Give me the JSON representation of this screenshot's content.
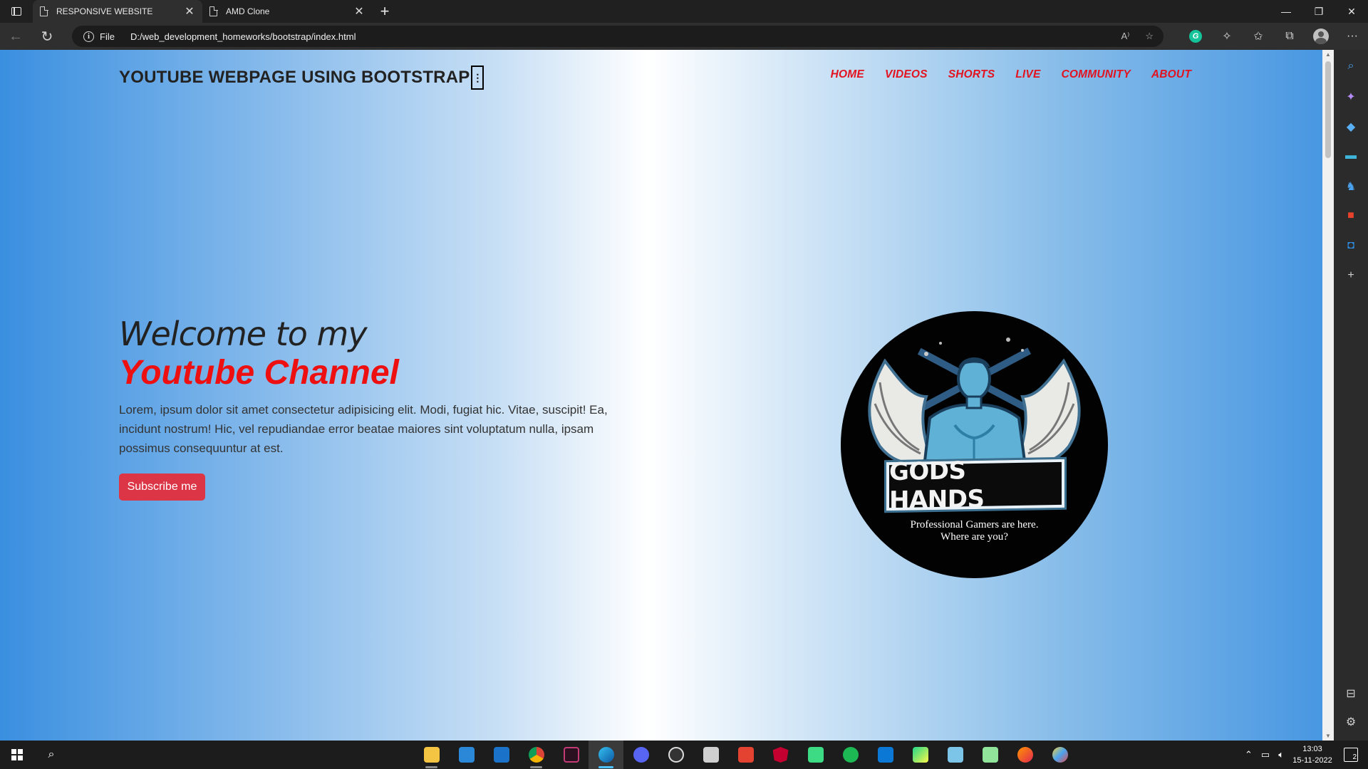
{
  "browser": {
    "tabs": [
      {
        "label": "RESPONSIVE WEBSITE",
        "active": true
      },
      {
        "label": "AMD Clone",
        "active": false
      }
    ],
    "address": {
      "scheme_label": "File",
      "url": "D:/web_development_homeworks/bootstrap/index.html"
    }
  },
  "page": {
    "brand": "YOUTUBE WEBPAGE USING BOOTSTRAP",
    "toggler_glyph": "⋮",
    "nav": [
      "HOME",
      "VIDEOS",
      "SHORTS",
      "LIVE",
      "COMMUNITY",
      "ABOUT"
    ],
    "hero": {
      "line1": "Welcome to my",
      "line2": "Youtube Channel",
      "paragraph": "Lorem, ipsum dolor sit amet consectetur adipisicing elit. Modi, fugiat hic. Vitae, suscipit! Ea, incidunt nostrum! Hic, vel repudiandae error beatae maiores sint voluptatum nulla, ipsam possimus consequuntur at est.",
      "button": "Subscribe me"
    },
    "logo": {
      "title": "GODS HANDS",
      "tagline_1": "Professional Gamers are here.",
      "tagline_2": "Where are you?"
    }
  },
  "taskbar": {
    "time": "13:03",
    "date": "15-11-2022",
    "notification_count": "2",
    "apps": [
      "file-explorer",
      "microsoft-store",
      "mail",
      "chrome",
      "vscodium",
      "edge",
      "discord",
      "obs",
      "photos",
      "todoist",
      "angular",
      "android-studio",
      "spotify",
      "vscode",
      "pycharm",
      "notepad",
      "notepad-plus-plus",
      "firefox",
      "paint"
    ]
  },
  "colors": {
    "accent_red": "#e2131f",
    "button_red": "#dc3545",
    "gradient_blue": "#3a8fe0"
  }
}
